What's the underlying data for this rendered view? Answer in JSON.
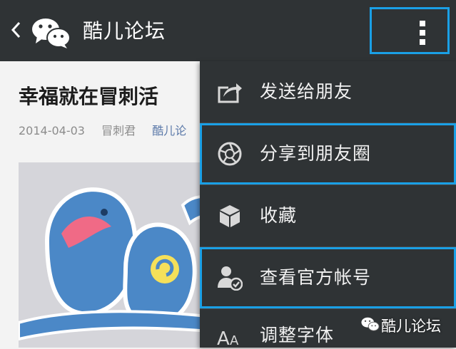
{
  "topbar": {
    "back_icon": "chevron-left-icon",
    "logo_icon": "wechat-logo-icon",
    "title": "酷儿论坛",
    "more_icon": "more-vertical-icon"
  },
  "article": {
    "title": "幸福就在冒刺活",
    "date": "2014-04-03",
    "author": "冒刺君",
    "source": "酷儿论"
  },
  "menu": {
    "items": [
      {
        "label": "发送给朋友",
        "icon": "share-icon"
      },
      {
        "label": "分享到朋友圈",
        "icon": "moments-aperture-icon"
      },
      {
        "label": "收藏",
        "icon": "favorite-cube-icon"
      },
      {
        "label": "查看官方帐号",
        "icon": "official-account-icon"
      },
      {
        "label": "调整字体",
        "icon": "font-size-icon"
      }
    ]
  },
  "watermark": {
    "text": "酷儿论坛",
    "icon": "wechat-logo-icon"
  },
  "colors": {
    "topbar_bg": "#2f3335",
    "menu_bg": "#2f3335",
    "highlight": "#1aa0e6",
    "article_bg": "#f3f3f3",
    "meta_text": "#8c8c8c",
    "meta_link": "#5a78a8"
  }
}
